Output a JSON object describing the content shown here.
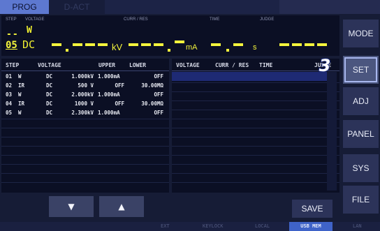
{
  "tabs": {
    "prog": "PROG",
    "dact": "D-ACT"
  },
  "readout": {
    "step_label": "STEP",
    "voltage_label": "VOLTAGE",
    "curr_label": "CURR / RES",
    "time_label": "TIME",
    "judge_label": "JUDGE",
    "step_top": "--",
    "step_num": "05",
    "w_mark": "W",
    "dc_mark": "DC",
    "kv_unit": "kV",
    "ma_unit": "mA",
    "s_unit": "s"
  },
  "left_table": {
    "headers": [
      "STEP",
      "VOLTAGE",
      "UPPER",
      "LOWER"
    ],
    "rows": [
      {
        "step": "01",
        "mode": "W",
        "dc": "DC",
        "voltage": "1.000kV",
        "upper": "1.000mA",
        "lower": "OFF"
      },
      {
        "step": "02",
        "mode": "IR",
        "dc": "DC",
        "voltage": "500 V",
        "upper": "OFF",
        "lower": "30.00MΩ"
      },
      {
        "step": "03",
        "mode": "W",
        "dc": "DC",
        "voltage": "2.000kV",
        "upper": "1.000mA",
        "lower": "OFF"
      },
      {
        "step": "04",
        "mode": "IR",
        "dc": "DC",
        "voltage": "1000 V",
        "upper": "OFF",
        "lower": "30.00MΩ"
      },
      {
        "step": "05",
        "mode": "W",
        "dc": "DC",
        "voltage": "2.300kV",
        "upper": "1.000mA",
        "lower": "OFF"
      }
    ]
  },
  "right_table": {
    "headers": [
      "VOLTAGE",
      "CURR / RES",
      "TIME",
      "JUDGE"
    ]
  },
  "side_buttons": [
    "MODE",
    "SET",
    "ADJ",
    "PANEL",
    "SYS",
    "FILE"
  ],
  "badge_number": "3",
  "bottom": {
    "down_icon": "▼",
    "up_icon": "▲",
    "save": "SAVE"
  },
  "status": {
    "ext": "EXT",
    "keylock": "KEYLOCK",
    "local": "LOCAL",
    "usb": "USB MEM",
    "lan": "LAN"
  },
  "colors": {
    "accent": "#f4f43c",
    "tab_active": "#5d78d0",
    "usb_active": "#3f63c8"
  }
}
